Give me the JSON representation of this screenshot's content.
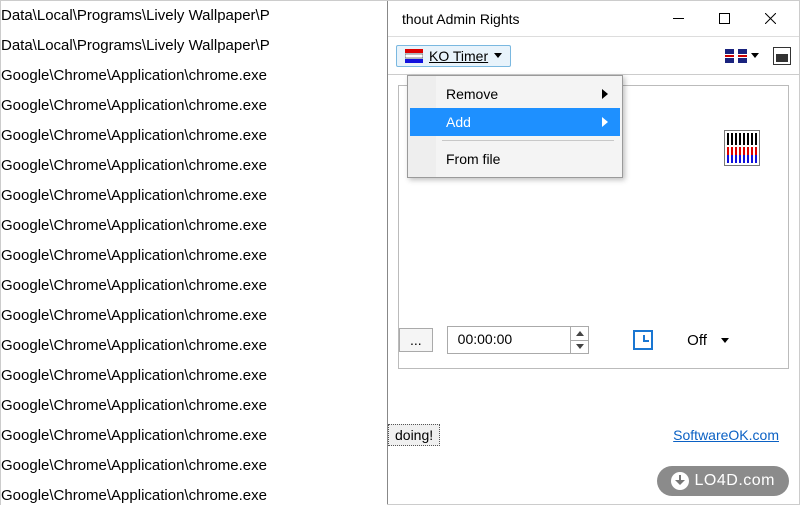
{
  "left_paths": [
    "Data\\Local\\Programs\\Lively Wallpaper\\P",
    "Data\\Local\\Programs\\Lively Wallpaper\\P",
    "Google\\Chrome\\Application\\chrome.exe",
    "Google\\Chrome\\Application\\chrome.exe",
    "Google\\Chrome\\Application\\chrome.exe",
    "Google\\Chrome\\Application\\chrome.exe",
    "Google\\Chrome\\Application\\chrome.exe",
    "Google\\Chrome\\Application\\chrome.exe",
    "Google\\Chrome\\Application\\chrome.exe",
    "Google\\Chrome\\Application\\chrome.exe",
    "Google\\Chrome\\Application\\chrome.exe",
    "Google\\Chrome\\Application\\chrome.exe",
    "Google\\Chrome\\Application\\chrome.exe",
    "Google\\Chrome\\Application\\chrome.exe",
    "Google\\Chrome\\Application\\chrome.exe",
    "Google\\Chrome\\Application\\chrome.exe",
    "Google\\Chrome\\Application\\chrome.exe"
  ],
  "titlebar": {
    "title": "thout Admin Rights"
  },
  "toolbar": {
    "kotimer_label": "KO Timer"
  },
  "menu": {
    "remove": "Remove",
    "add": "Add",
    "from_file": "From file"
  },
  "timer": {
    "value": "00:00:00",
    "ellipsis": "...",
    "state_label": "Off"
  },
  "bottom": {
    "doing_label": "doing!",
    "link_label": "SoftwareOK.com"
  },
  "watermark": {
    "text": "LO4D.com"
  }
}
